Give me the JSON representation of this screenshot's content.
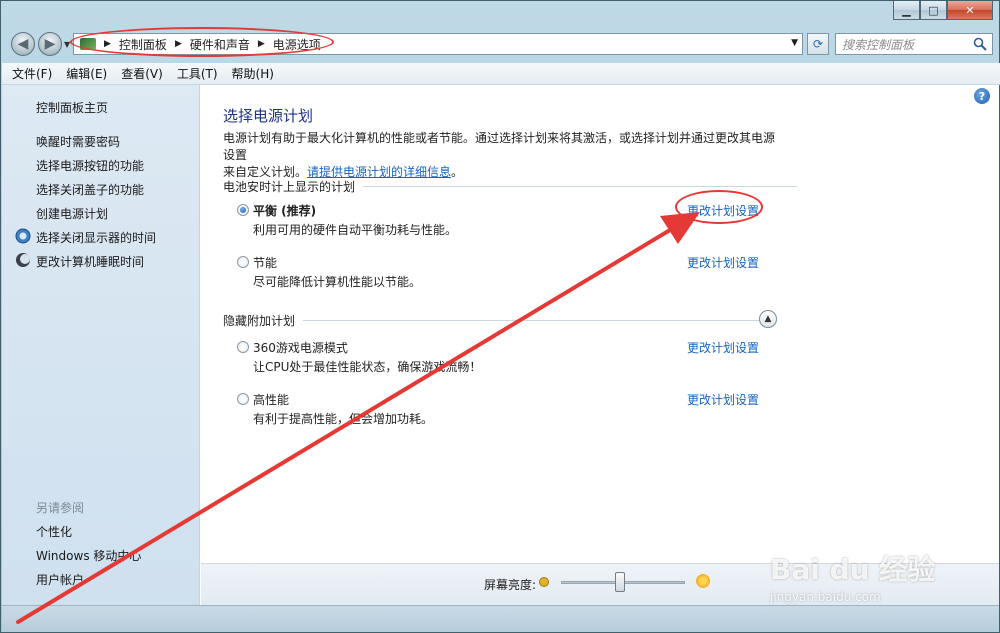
{
  "breadcrumb": [
    "控制面板",
    "硬件和声音",
    "电源选项"
  ],
  "search": {
    "placeholder": "搜索控制面板"
  },
  "menu": [
    "文件(F)",
    "编辑(E)",
    "查看(V)",
    "工具(T)",
    "帮助(H)"
  ],
  "sidebar": {
    "home": "控制面板主页",
    "items": [
      {
        "label": "唤醒时需要密码",
        "icon": ""
      },
      {
        "label": "选择电源按钮的功能",
        "icon": ""
      },
      {
        "label": "选择关闭盖子的功能",
        "icon": ""
      },
      {
        "label": "创建电源计划",
        "icon": ""
      },
      {
        "label": "选择关闭显示器的时间",
        "icon": "monitor-icon"
      },
      {
        "label": "更改计算机睡眠时间",
        "icon": "moon-icon"
      }
    ],
    "see_also_title": "另请参阅",
    "see_also": [
      "个性化",
      "Windows 移动中心",
      "用户帐户"
    ]
  },
  "main": {
    "title": "选择电源计划",
    "desc_line1": "电源计划有助于最大化计算机的性能或者节能。通过选择计划来将其激活，或选择计划并通过更改其电源设置",
    "desc_line2_prefix": "来自定义计划。",
    "desc_link": "请提供电源计划的详细信息",
    "desc_suffix": "。",
    "group1_title": "电池安时计上显示的计划",
    "group2_title": "隐藏附加计划",
    "plans": [
      {
        "name": "平衡 (推荐)",
        "desc": "利用可用的硬件自动平衡功耗与性能。",
        "link": "更改计划设置",
        "selected": true
      },
      {
        "name": "节能",
        "desc": "尽可能降低计算机性能以节能。",
        "link": "更改计划设置",
        "selected": false
      },
      {
        "name": "360游戏电源模式",
        "desc": "让CPU处于最佳性能状态，确保游戏流畅！",
        "link": "更改计划设置",
        "selected": false
      },
      {
        "name": "高性能",
        "desc": "有利于提高性能，但会增加功耗。",
        "link": "更改计划设置",
        "selected": false
      }
    ]
  },
  "brightness": {
    "label": "屏幕亮度:",
    "level": 0.45
  },
  "watermark": {
    "brand": "Bai du 经验",
    "url": "jingyan.baidu.com"
  },
  "colors": {
    "link": "#1565c0",
    "title": "#1e3287",
    "annotation": "#e53935"
  }
}
